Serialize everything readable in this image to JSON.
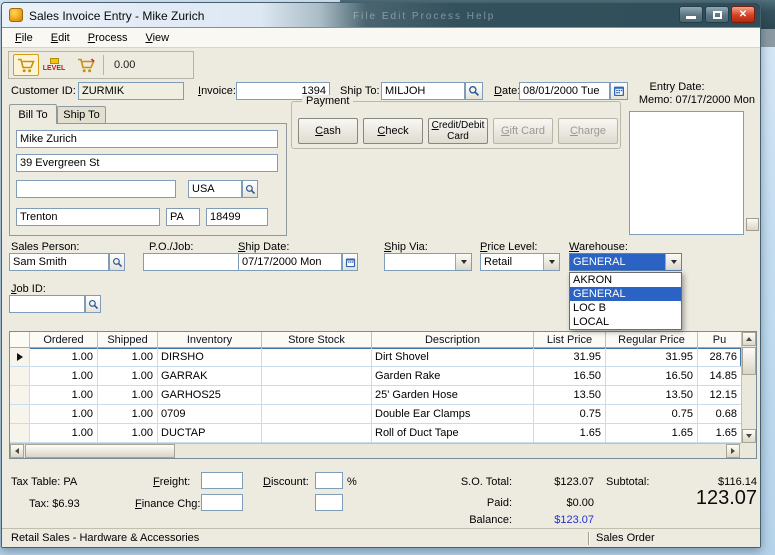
{
  "desktop": {
    "background_window": {
      "menu_text": "File  Edit  Process  Help"
    }
  },
  "window": {
    "title": "Sales Invoice Entry - Mike Zurich",
    "menu_items": [
      "File",
      "Edit",
      "Process",
      "View"
    ],
    "toolbar": {
      "level_label": "LEVEL",
      "amount": "0.00"
    }
  },
  "invoice_header": {
    "customer_id_label": "Customer ID:",
    "customer_id_value": "ZURMIK",
    "invoice_label": "Invoice:",
    "invoice_value": "1394",
    "ship_to_label": "Ship To:",
    "ship_to_value": "MILJOH",
    "date_label": "Date:",
    "date_value": "08/01/2000 Tue",
    "entry_date_label": "Entry Date:",
    "memo_value": "Memo: 07/17/2000 Mon"
  },
  "address_tabs": {
    "bill_to_label": "Bill To",
    "ship_to_label": "Ship To"
  },
  "bill_to": {
    "name": "Mike Zurich",
    "street": "39 Evergreen St",
    "line3": "",
    "country": "USA",
    "city": "Trenton",
    "state": "PA",
    "zip": "18499"
  },
  "payment": {
    "group_label": "Payment",
    "cash": "Cash",
    "check": "Check",
    "credit": "Credit/Debit Card",
    "gift": "Gift Card",
    "charge": "Charge"
  },
  "order_info": {
    "sales_person_label": "Sales Person:",
    "sales_person_value": "Sam Smith",
    "po_job_label": "P.O./Job:",
    "po_job_value": "",
    "ship_date_label": "Ship Date:",
    "ship_date_value": "07/17/2000 Mon",
    "ship_via_label": "Ship Via:",
    "ship_via_value": "",
    "price_level_label": "Price Level:",
    "price_level_value": "Retail",
    "warehouse_label": "Warehouse:",
    "warehouse_value": "GENERAL",
    "warehouse_options": [
      "AKRON",
      "GENERAL",
      "LOC B",
      "LOCAL"
    ],
    "job_id_label": "Job ID:",
    "job_id_value": ""
  },
  "line_items": {
    "columns": {
      "ordered": "Ordered",
      "shipped": "Shipped",
      "inventory": "Inventory",
      "store_stock": "Store Stock",
      "description": "Description",
      "list_price": "List Price",
      "regular_price": "Regular Price",
      "price_truncated": "Pu"
    },
    "rows": [
      {
        "ordered": "1.00",
        "shipped": "1.00",
        "inventory": "DIRSHO",
        "store_stock": "",
        "description": "Dirt Shovel",
        "list_price": "31.95",
        "regular_price": "31.95",
        "price": "28.76"
      },
      {
        "ordered": "1.00",
        "shipped": "1.00",
        "inventory": "GARRAK",
        "store_stock": "",
        "description": "Garden Rake",
        "list_price": "16.50",
        "regular_price": "16.50",
        "price": "14.85"
      },
      {
        "ordered": "1.00",
        "shipped": "1.00",
        "inventory": "GARHOS25",
        "store_stock": "",
        "description": "25' Garden Hose",
        "list_price": "13.50",
        "regular_price": "13.50",
        "price": "12.15"
      },
      {
        "ordered": "1.00",
        "shipped": "1.00",
        "inventory": "0709",
        "store_stock": "",
        "description": "Double Ear Clamps",
        "list_price": "0.75",
        "regular_price": "0.75",
        "price": "0.68"
      },
      {
        "ordered": "1.00",
        "shipped": "1.00",
        "inventory": "DUCTAP",
        "store_stock": "",
        "description": "Roll of Duct Tape",
        "list_price": "1.65",
        "regular_price": "1.65",
        "price": "1.65"
      }
    ]
  },
  "totals": {
    "tax_table_label": "Tax Table:",
    "tax_table_value": "PA",
    "tax_label": "Tax:",
    "tax_value": "$6.93",
    "freight_label": "Freight:",
    "freight_value": "",
    "discount_label": "Discount:",
    "discount_value": "",
    "percent_sign": "%",
    "finance_chg_label": "Finance Chg:",
    "finance_chg_value": "",
    "extra_value": "",
    "so_total_label": "S.O. Total:",
    "so_total_value": "$123.07",
    "paid_label": "Paid:",
    "paid_value": "$0.00",
    "balance_label": "Balance:",
    "balance_value": "$123.07",
    "subtotal_label": "Subtotal:",
    "subtotal_value": "$116.14",
    "grand_total": "123.07"
  },
  "status_bar": {
    "left_text": "Retail Sales - Hardware & Accessories",
    "right_text": "Sales Order"
  }
}
